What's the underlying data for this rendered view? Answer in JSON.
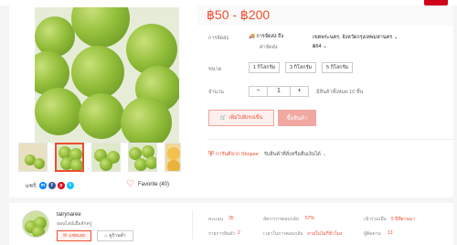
{
  "product": {
    "price_range": "฿50 - ฿200",
    "shipping": {
      "label": "การจัดส่ง",
      "to_label": "การจัดส่ง ถึง",
      "to_value": "เขตพระนคร, จังหวัดกรุงเทพมหานคร",
      "fee_label": "ค่าจัดส่ง",
      "fee_value": "฿64"
    },
    "option_label": "ขนาด",
    "options": [
      "1 กิโลกรัม",
      "3 กิโลกรัม",
      "5 กิโลกรัม"
    ],
    "quantity": {
      "label": "จำนวน",
      "minus": "−",
      "value": "1",
      "plus": "+",
      "stock_text": "มีสินค้าทั้งหมด 10 ชิ้น"
    },
    "add_to_cart_label": "เพิ่มไปยังรถเข็น",
    "buy_now_label": "ซื้อสินค้า",
    "guarantee": {
      "brand": "การันตีจาก Shopee",
      "text": "รับสินค้าที่สั่งหรือคืนเงินได้"
    },
    "share_label": "แชร์:",
    "share_icons": [
      {
        "name": "messenger-icon",
        "glyph": "m",
        "color": "#0084ff"
      },
      {
        "name": "facebook-icon",
        "glyph": "f",
        "color": "#3b5999"
      },
      {
        "name": "pinterest-icon",
        "glyph": "p",
        "color": "#de0217"
      },
      {
        "name": "twitter-icon",
        "glyph": "t",
        "color": "#10c2ff"
      }
    ],
    "favorite_label": "Favorite (40)"
  },
  "shop": {
    "name": "tairynaree",
    "status": "ออนไลน์เมื่อสักครู่",
    "chat_label": "แชทเลย",
    "view_shop_label": "ดูร้านค้า",
    "stats": [
      {
        "label": "คะแนน",
        "value": "35"
      },
      {
        "label": "อัตราการตอบกลับ",
        "value": "57%"
      },
      {
        "label": "เข้าร่วมเมื่อ",
        "value": "5 ปีที่ผ่านมา"
      },
      {
        "label": "รายการสินค้า",
        "value": "2"
      },
      {
        "label": "เวลาในการตอบกลับ",
        "value": "ภายในไม่กี่ชั่วโมง"
      },
      {
        "label": "ผู้ติดตาม",
        "value": "13"
      }
    ]
  },
  "colors": {
    "accent": "#ee4d2d",
    "background": "#f5f5f5"
  }
}
